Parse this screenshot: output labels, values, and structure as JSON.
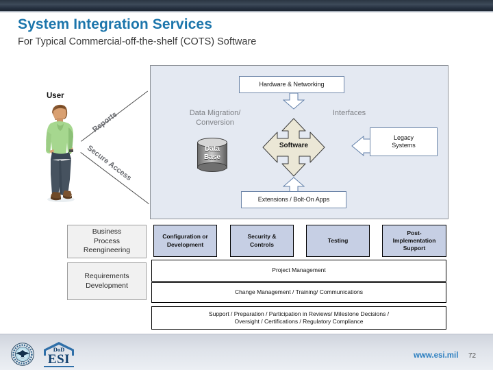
{
  "header": {
    "title": "System Integration Services",
    "subtitle": "For Typical Commercial-off-the-shelf (COTS) Software",
    "title_color": "#1b75ab"
  },
  "diagram": {
    "user_label": "User",
    "flow_labels": [
      {
        "text": "Reports"
      },
      {
        "text": "Secure Access"
      }
    ],
    "ghost_labels": [
      {
        "text": "Data Migration/ Conversion"
      },
      {
        "text": "Interfaces"
      }
    ],
    "data_migration_label_line1": "Data Migration/",
    "data_migration_label_line2": "Conversion",
    "interfaces_label": "Interfaces",
    "database": {
      "line1": "Data",
      "line2": "Base"
    },
    "center": {
      "label": "Software",
      "fill": "#ebe7d6"
    },
    "boxes": {
      "top": "Hardware & Networking",
      "bottom": "Extensions / Bolt-On Apps",
      "right_line1": "Legacy",
      "right_line2": "Systems"
    },
    "panel_fill": "#e4e9f2"
  },
  "grid": {
    "left_cells": [
      {
        "lines": [
          "Business",
          "Process",
          "Reengineering"
        ]
      },
      {
        "lines": [
          "Requirements",
          "Development"
        ]
      }
    ],
    "phase_cells": [
      {
        "lines": [
          "Configuration or",
          "Development"
        ]
      },
      {
        "lines": [
          "Security &",
          "Controls"
        ]
      },
      {
        "lines": [
          "Testing"
        ]
      },
      {
        "lines": [
          "Post-",
          "Implementation",
          "Support"
        ]
      }
    ],
    "span_rows": [
      {
        "lines": [
          "Project Management"
        ]
      },
      {
        "lines": [
          "Change Management / Training/ Communications"
        ]
      },
      {
        "lines": [
          "Support / Preparation / Participation in Reviews/ Milestone Decisions /",
          "Oversight / Certifications / Regulatory Compliance"
        ]
      }
    ],
    "blue_fill": "#c6cfe4",
    "gray_fill": "#f1f1f1"
  },
  "footer": {
    "website": "www.esi.mil",
    "page_number": "72",
    "logo_dod": "DoD",
    "logo_esi": "ESI"
  }
}
